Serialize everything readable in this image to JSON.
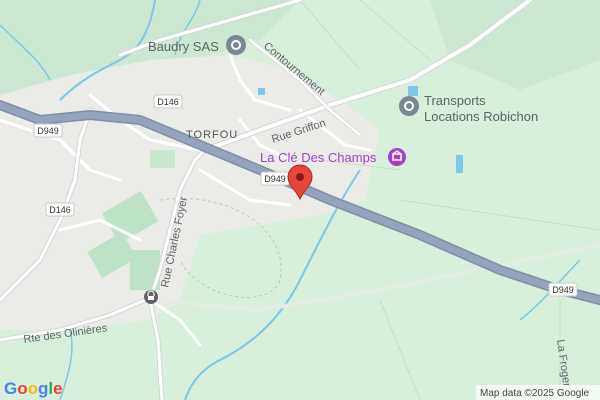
{
  "map": {
    "place_name": "TORFOU",
    "roads": {
      "d949_shields": [
        "D949",
        "D949",
        "D949"
      ],
      "d146_shields": [
        "D146",
        "D146"
      ],
      "rue_griffon": "Rue Griffon",
      "contournement": "Contournement",
      "rue_charles_foyer": "Rue Charles Foyer",
      "rte_des_olinieres": "Rte des Olinières",
      "la_froger": "La Froger"
    },
    "pois": {
      "baudry": "Baudry SAS",
      "transports_line1": "Transports",
      "transports_line2": "Locations Robichon",
      "la_cle": "La Clé Des Champs"
    },
    "icons": {
      "gray_poi": "generic-poi-icon",
      "purple_poi": "attraction-icon",
      "marker": "location-pin-icon",
      "locked": "town-hall-icon"
    },
    "colors": {
      "background": "#d8efdc",
      "urban": "#ebebe8",
      "highway": "#8d9bb3",
      "water": "#7cc8e8",
      "marker": "#e8453c",
      "purple": "#a142c9"
    }
  },
  "footer": {
    "logo": "Google",
    "attribution": "Map data ©2025 Google"
  }
}
